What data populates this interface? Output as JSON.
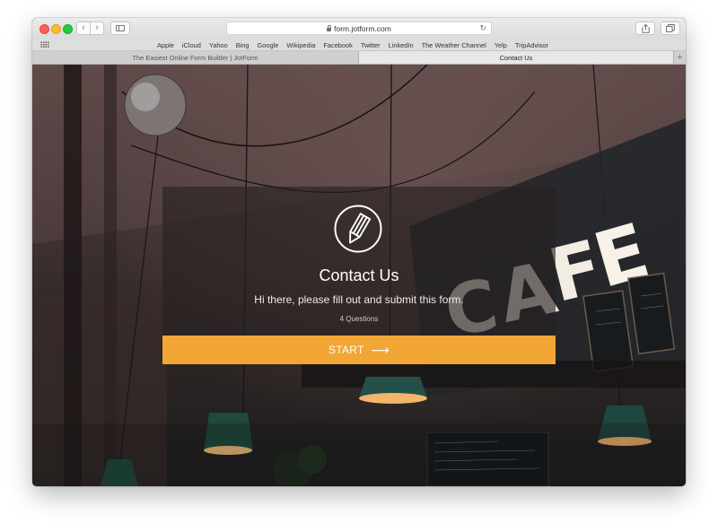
{
  "browser": {
    "url": "form.jotform.com",
    "bookmarks": [
      "Apple",
      "iCloud",
      "Yahoo",
      "Bing",
      "Google",
      "Wikipedia",
      "Facebook",
      "Twitter",
      "LinkedIn",
      "The Weather Channel",
      "Yelp",
      "TripAdvisor"
    ],
    "tabs": [
      {
        "label": "The Easiest Online Form Builder | JotForm",
        "active": false
      },
      {
        "label": "Contact Us",
        "active": true
      }
    ],
    "icons": {
      "back": "chevron-left-icon",
      "forward": "chevron-right-icon",
      "sidebar": "sidebar-icon",
      "lock": "lock-icon",
      "reload": "reload-icon",
      "share": "share-icon",
      "tabs_overview": "tabs-icon",
      "new_tab": "plus-icon",
      "top_sites": "grid-icon"
    }
  },
  "form": {
    "title": "Contact Us",
    "subtitle": "Hi there, please fill out and submit this form.",
    "question_count": "4 Questions",
    "start_label": "START",
    "start_icon": "arrow-right-icon",
    "logo_icon": "pencil-icon",
    "accent_color": "#f2a635"
  },
  "background": {
    "sign_letters": [
      "C",
      "A",
      "F",
      "E"
    ]
  }
}
